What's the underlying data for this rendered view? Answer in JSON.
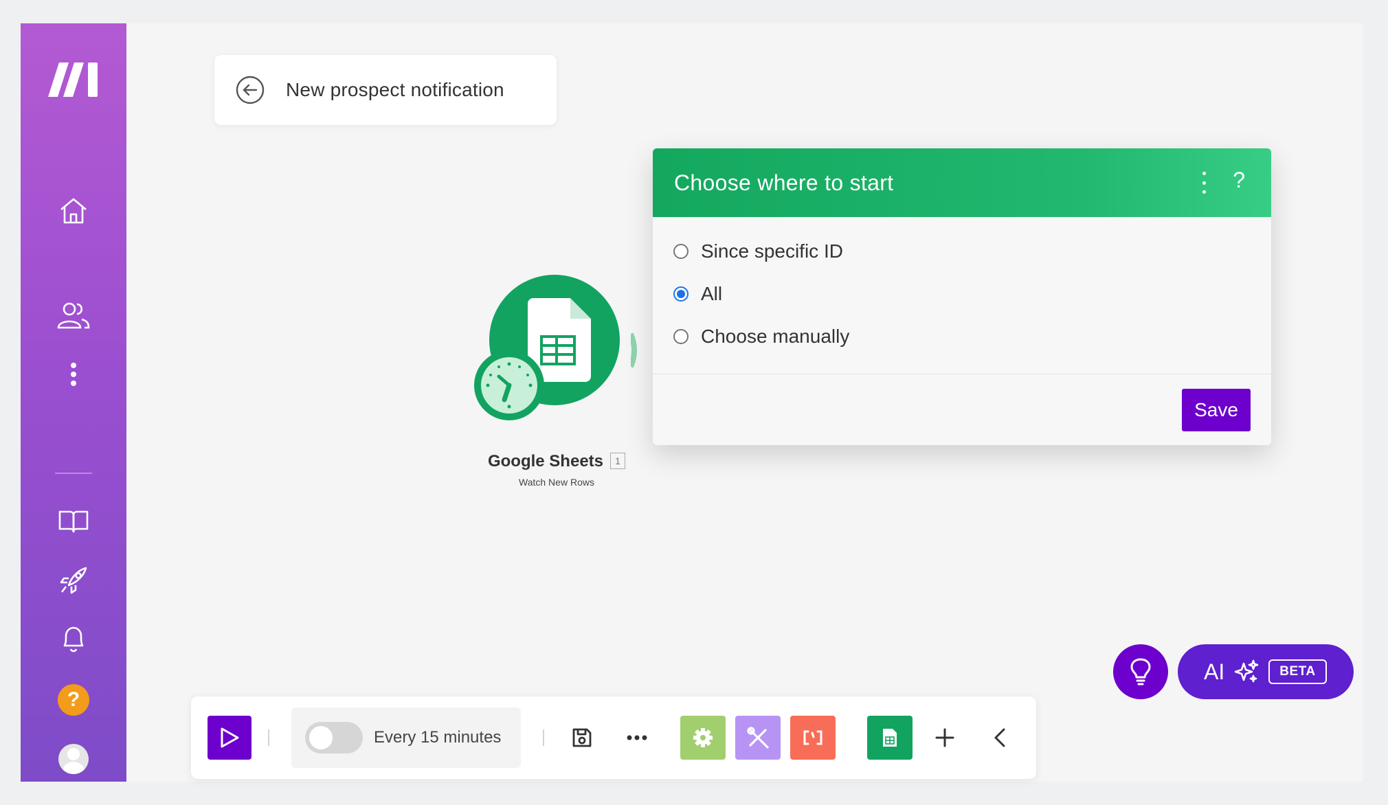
{
  "app": {
    "brand_logo": "make-logo-icon"
  },
  "sidebar": {
    "items": [
      {
        "name": "home",
        "icon": "home-icon"
      },
      {
        "name": "team",
        "icon": "users-icon"
      },
      {
        "name": "more",
        "icon": "vertical-dots-icon"
      },
      {
        "name": "docs",
        "icon": "book-icon"
      },
      {
        "name": "whats-new",
        "icon": "rocket-icon"
      },
      {
        "name": "notifications",
        "icon": "bell-icon"
      },
      {
        "name": "help",
        "icon": "help-icon",
        "label": "?"
      },
      {
        "name": "profile",
        "icon": "avatar-icon"
      }
    ]
  },
  "scenario": {
    "title": "New prospect notification"
  },
  "module": {
    "app": "Google Sheets",
    "id_badge": "1",
    "action": "Watch New Rows",
    "color": "#12a360"
  },
  "popup": {
    "title": "Choose where to start",
    "help_label": "?",
    "options": [
      {
        "label": "Since specific ID",
        "checked": false
      },
      {
        "label": "All",
        "checked": true
      },
      {
        "label": "Choose manually",
        "checked": false
      }
    ],
    "save_label": "Save"
  },
  "toolbar": {
    "schedule_label": "Every 15 minutes",
    "schedule_enabled": false,
    "tools": [
      {
        "name": "run-once",
        "icon": "play-icon",
        "color": "#6d00cc"
      },
      {
        "name": "save",
        "icon": "save-icon"
      },
      {
        "name": "more",
        "icon": "horizontal-dots-icon"
      },
      {
        "name": "settings",
        "icon": "gear-icon",
        "color": "#a2cf6e"
      },
      {
        "name": "tools",
        "icon": "tools-icon",
        "color": "#b794f4"
      },
      {
        "name": "flow-control",
        "icon": "bracket-icon",
        "color": "#f76d57"
      },
      {
        "name": "google-sheets",
        "icon": "sheets-icon",
        "color": "#12a360"
      },
      {
        "name": "add",
        "icon": "plus-icon"
      },
      {
        "name": "collapse",
        "icon": "chevron-left-icon"
      }
    ]
  },
  "floating": {
    "ai_label": "AI",
    "beta_label": "BETA",
    "accent": "#6d00cc"
  }
}
